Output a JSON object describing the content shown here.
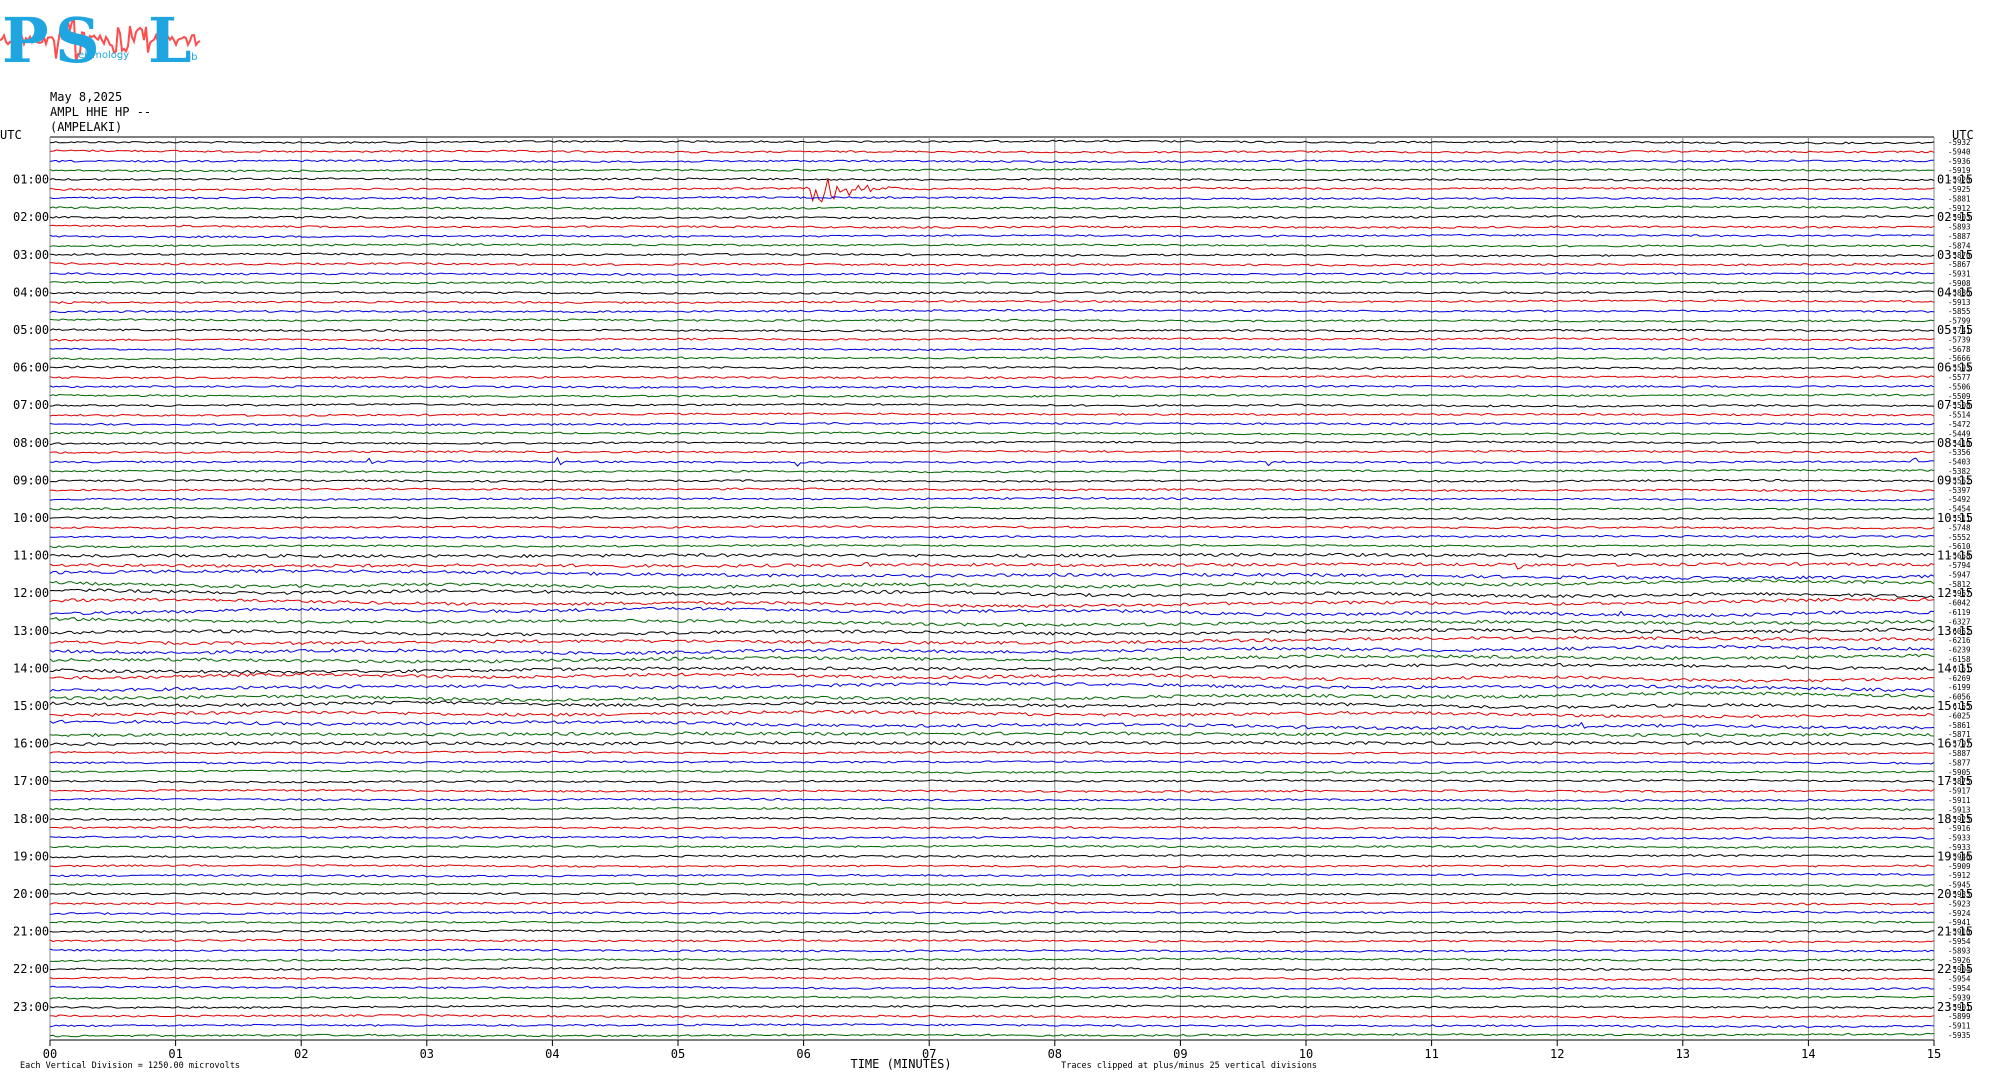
{
  "header": {
    "date": "May 8,2025",
    "channel": "AMPL HHE HP --",
    "station": "(AMPELAKI)"
  },
  "logo": {
    "name": "PSL-logo",
    "text": "PSL",
    "letters": [
      "P",
      "S",
      "L"
    ],
    "subtitle_fragment": "eismology",
    "suffix_fragment": "ab",
    "colors": {
      "text": "#1fa6e0",
      "wave": "#ff4d4d"
    }
  },
  "footer": {
    "scale_note": "Each Vertical Division = 1250.00 microvolts",
    "x_axis_title": "TIME (MINUTES)",
    "clip_note": "Traces clipped at plus/minus 25 vertical divisions"
  },
  "colors": {
    "trace_cycle": [
      "#000000",
      "#dd0000",
      "#0000dd",
      "#006600"
    ],
    "grid": "#888888",
    "text": "#000000"
  },
  "chart_data": {
    "type": "line",
    "subtype": "helicorder",
    "xlabel": "TIME (MINUTES)",
    "xlim": [
      0,
      15
    ],
    "x_ticks": [
      "00",
      "01",
      "02",
      "03",
      "04",
      "05",
      "06",
      "07",
      "08",
      "09",
      "10",
      "11",
      "12",
      "13",
      "14",
      "15"
    ],
    "left_axis_label": "UTC",
    "right_axis_label": "UTC",
    "left_hour_labels": [
      "01:00",
      "02:00",
      "03:00",
      "04:00",
      "05:00",
      "06:00",
      "07:00",
      "08:00",
      "09:00",
      "10:00",
      "11:00",
      "12:00",
      "13:00",
      "14:00",
      "15:00",
      "16:00",
      "17:00",
      "18:00",
      "19:00",
      "20:00",
      "21:00",
      "22:00",
      "23:00"
    ],
    "right_hour_labels": [
      "01:15",
      "02:15",
      "03:15",
      "04:15",
      "05:15",
      "06:15",
      "07:15",
      "08:15",
      "09:15",
      "10:15",
      "11:15",
      "12:15",
      "13:15",
      "14:15",
      "15:15",
      "16:15",
      "17:15",
      "18:15",
      "19:15",
      "20:15",
      "21:15",
      "22:15",
      "23:15"
    ],
    "traces_per_hour": 4,
    "trace_count": 96,
    "trace_offsets": [
      "-5932",
      "-5940",
      "-5936",
      "-5919",
      "-5920",
      "-5925",
      "-5881",
      "-5912",
      "-5903",
      "-5893",
      "-5887",
      "-5874",
      "-5870",
      "-5867",
      "-5931",
      "-5908",
      "-5886",
      "-5913",
      "-5855",
      "-5799",
      "-5741",
      "-5739",
      "-5678",
      "-5666",
      "-5593",
      "-5577",
      "-5506",
      "-5509",
      "-5508",
      "-5514",
      "-5472",
      "-5449",
      "-5410",
      "-5356",
      "-5403",
      "-5382",
      "-5562",
      "-5397",
      "-5492",
      "-5454",
      "-5511",
      "-5748",
      "-5552",
      "-5610",
      "-5658",
      "-5794",
      "-5947",
      "-5812",
      "-5957",
      "-6042",
      "-6119",
      "-6327",
      "-6052",
      "-6216",
      "-6239",
      "-6158",
      "-6151",
      "-6269",
      "-6199",
      "-6056",
      "-6155",
      "-6025",
      "-5861",
      "-5871",
      "-5797",
      "-5887",
      "-5877",
      "-5905",
      "-5875",
      "-5917",
      "-5911",
      "-5913",
      "-5923",
      "-5916",
      "-5933",
      "-5933",
      "-5946",
      "-5909",
      "-5912",
      "-5945",
      "-5933",
      "-5923",
      "-5924",
      "-5941",
      "-5910",
      "-5954",
      "-5893",
      "-5926",
      "-5904",
      "-5954",
      "-5954",
      "-5939",
      "-5901",
      "-5899",
      "-5911",
      "-5935"
    ],
    "events": [
      {
        "trace_index": 5,
        "start_min": 6.0,
        "end_min": 7.0,
        "peak_amplitude_divisions": 2.2,
        "description": "local earthquake"
      }
    ],
    "noise_spikes": [
      {
        "trace_index": 34,
        "times_min": [
          2.55,
          3.1,
          4.05,
          5.95,
          9.7,
          14.85
        ]
      },
      {
        "trace_index": 45,
        "times_min": [
          6.5,
          8.8,
          11.7
        ]
      },
      {
        "trace_index": 50,
        "times_min": [
          11.3,
          12.5
        ]
      },
      {
        "trace_index": 62,
        "times_min": [
          12.2
        ]
      }
    ],
    "grid": true
  }
}
